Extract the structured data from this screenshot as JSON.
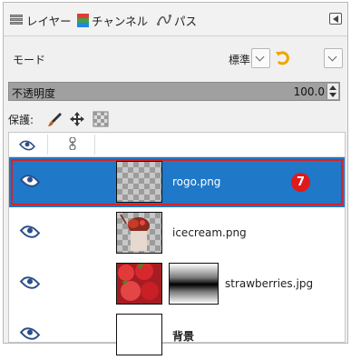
{
  "tabs": {
    "layers": "レイヤー",
    "channels": "チャンネル",
    "paths": "パス"
  },
  "mode": {
    "label": "モード",
    "value": "標準"
  },
  "opacity": {
    "label": "不透明度",
    "value": "100.0"
  },
  "lock": {
    "label": "保護:"
  },
  "layers": [
    {
      "name": "rogo.png",
      "selected": true,
      "visible": true,
      "badge": "7"
    },
    {
      "name": "icecream.png",
      "selected": false,
      "visible": true
    },
    {
      "name": "strawberries.jpg",
      "selected": false,
      "visible": true,
      "has_mask": true
    },
    {
      "name": "背景",
      "selected": false,
      "visible": true
    }
  ],
  "colors": {
    "selection": "#1f78c8",
    "selection_outline": "#e02020",
    "badge": "#e0191b",
    "eye": "#2b4f8a"
  }
}
